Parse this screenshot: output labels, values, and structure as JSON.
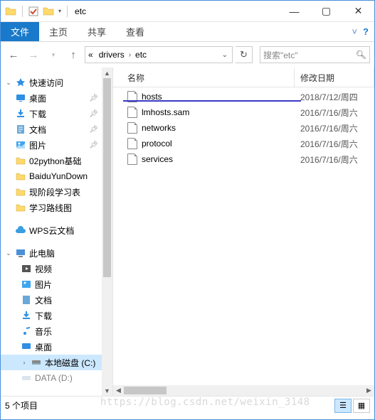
{
  "window": {
    "title": "etc"
  },
  "ribbon": {
    "tabs": {
      "file": "文件",
      "home": "主页",
      "share": "共享",
      "view": "查看"
    }
  },
  "address": {
    "prefix": "«",
    "crumb1": "drivers",
    "crumb2": "etc"
  },
  "search": {
    "placeholder": "搜索\"etc\""
  },
  "nav": {
    "quick_access": "快速访问",
    "desktop": "桌面",
    "downloads": "下载",
    "documents": "文档",
    "pictures": "图片",
    "f1": "02python基础",
    "f2": "BaiduYunDown",
    "f3": "现阶段学习表",
    "f4": "学习路线图",
    "wps": "WPS云文档",
    "this_pc": "此电脑",
    "video": "视频",
    "pictures2": "图片",
    "documents2": "文档",
    "downloads2": "下载",
    "music": "音乐",
    "desktop2": "桌面",
    "drive_c": "本地磁盘 (C:)",
    "drive_d": "DATA (D:)"
  },
  "columns": {
    "name": "名称",
    "date": "修改日期"
  },
  "files": [
    {
      "name": "hosts",
      "date": "2018/7/12/周四"
    },
    {
      "name": "lmhosts.sam",
      "date": "2016/7/16/周六"
    },
    {
      "name": "networks",
      "date": "2016/7/16/周六"
    },
    {
      "name": "protocol",
      "date": "2016/7/16/周六"
    },
    {
      "name": "services",
      "date": "2016/7/16/周六"
    }
  ],
  "status": {
    "count": "5 个项目"
  },
  "watermark": "https://blog.csdn.net/weixin_3148"
}
